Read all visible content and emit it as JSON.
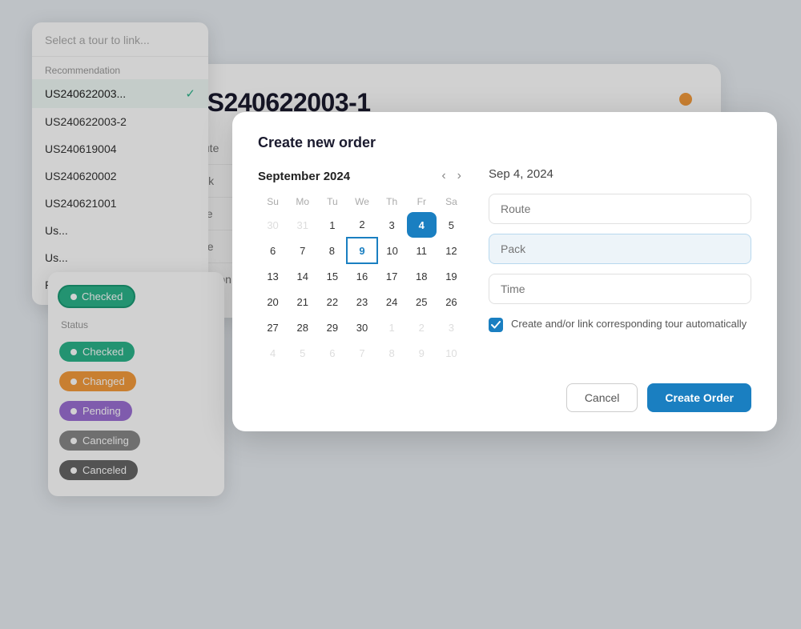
{
  "tourDropdown": {
    "searchPlaceholder": "Select a tour to link...",
    "sectionLabel": "Recommendation",
    "items": [
      {
        "id": "US240622003-1",
        "label": "US240622003...",
        "selected": true
      },
      {
        "id": "US240622003-2",
        "label": "US240622003-2",
        "selected": false
      },
      {
        "id": "US240619004",
        "label": "US240619004",
        "selected": false
      },
      {
        "id": "US240620002",
        "label": "US240620002",
        "selected": false
      },
      {
        "id": "US240621001",
        "label": "US240621001",
        "selected": false
      },
      {
        "id": "US7",
        "label": "Us...",
        "selected": false
      },
      {
        "id": "US8",
        "label": "Us...",
        "selected": false
      },
      {
        "id": "Pre",
        "label": "Pre...",
        "selected": false
      }
    ]
  },
  "statusDropdown": {
    "currentStatus": "Checked",
    "sectionLabel": "Status",
    "items": [
      {
        "key": "checked",
        "label": "Checked",
        "color": "#2bb48a",
        "dotColor": "#fff"
      },
      {
        "key": "changed",
        "label": "Changed",
        "color": "#f59c3c",
        "dotColor": "#fff"
      },
      {
        "key": "pending",
        "label": "Pending",
        "color": "#9b6fd4",
        "dotColor": "#fff"
      },
      {
        "key": "canceling",
        "label": "Canceling",
        "color": "#888888",
        "dotColor": "#fff"
      },
      {
        "key": "canceled",
        "label": "Canceled",
        "color": "#666666",
        "dotColor": "#fff"
      }
    ]
  },
  "orderCard": {
    "title": "US240622003-1",
    "statusDotColor": "#f59c3c",
    "fields": [
      {
        "label": "Route",
        "value": ""
      },
      {
        "label": "Pack",
        "value": ""
      },
      {
        "label": "Date",
        "value": ""
      },
      {
        "label": "Time",
        "value": ""
      },
      {
        "label": "Location",
        "value": ""
      }
    ]
  },
  "modal": {
    "title": "Create new order",
    "calendar": {
      "month": "September 2024",
      "weekdays": [
        "Su",
        "Mo",
        "Tu",
        "We",
        "Th",
        "Fr",
        "Sa"
      ],
      "weeks": [
        [
          {
            "day": 30,
            "other": true
          },
          {
            "day": 31,
            "other": true
          },
          {
            "day": 1
          },
          {
            "day": 2
          },
          {
            "day": 3
          },
          {
            "day": 4,
            "selected": true
          },
          {
            "day": 5
          }
        ],
        [
          {
            "day": 6
          },
          {
            "day": 7
          },
          {
            "day": 8
          },
          {
            "day": 9,
            "today": true
          },
          {
            "day": 10
          },
          {
            "day": 11
          },
          {
            "day": 12
          }
        ],
        [
          {
            "day": 13
          },
          {
            "day": 14
          },
          {
            "day": 15
          },
          {
            "day": 16
          },
          {
            "day": 17
          },
          {
            "day": 18
          },
          {
            "day": 19
          }
        ],
        [
          {
            "day": 20
          },
          {
            "day": 21
          },
          {
            "day": 22
          },
          {
            "day": 23
          },
          {
            "day": 24
          },
          {
            "day": 25
          },
          {
            "day": 26
          }
        ],
        [
          {
            "day": 27
          },
          {
            "day": 28
          },
          {
            "day": 29
          },
          {
            "day": 30
          },
          {
            "day": 1,
            "other": true
          },
          {
            "day": 2,
            "other": true
          },
          {
            "day": 3,
            "other": true
          }
        ],
        [
          {
            "day": 4,
            "other": true
          },
          {
            "day": 5,
            "other": true
          },
          {
            "day": 6,
            "other": true
          },
          {
            "day": 7,
            "other": true
          },
          {
            "day": 8,
            "other": true
          },
          {
            "day": 9,
            "other": true
          },
          {
            "day": 10,
            "other": true
          }
        ]
      ]
    },
    "rightPanel": {
      "dateDisplay": "Sep 4, 2024",
      "routePlaceholder": "Route",
      "packPlaceholder": "Pack",
      "timePlaceholder": "Time",
      "checkboxLabel": "Create and/or link corresponding tour automatically"
    },
    "cancelButton": "Cancel",
    "createButton": "Create Order"
  }
}
